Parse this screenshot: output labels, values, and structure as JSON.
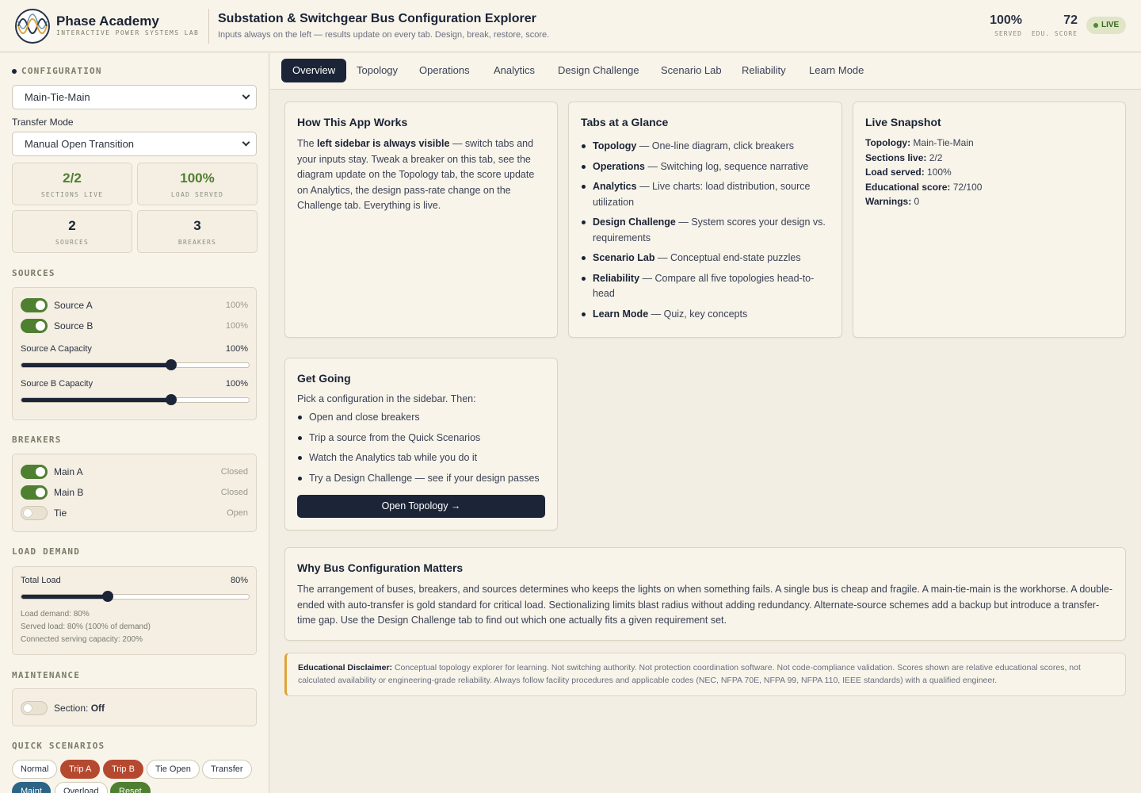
{
  "brand": {
    "name": "Phase Academy",
    "tagline": "INTERACTIVE POWER SYSTEMS LAB"
  },
  "app": {
    "title": "Substation & Switchgear Bus Configuration Explorer",
    "subtitle": "Inputs always on the left — results update on every tab. Design, break, restore, score."
  },
  "header_stats": [
    {
      "value": "100%",
      "label": "SERVED"
    },
    {
      "value": "72",
      "label": "EDU. SCORE"
    }
  ],
  "live_badge": "LIVE",
  "colors": {
    "navy": "#1c2438",
    "green": "#4f7f31",
    "red": "#b5492f",
    "blue": "#2b6486",
    "amber": "#e0a33a",
    "cream": "#f8f4ea"
  },
  "sidebar": {
    "config_title": "CONFIGURATION",
    "configuration": "Main-Tie-Main",
    "transfer_label": "Transfer Mode",
    "transfer_mode": "Manual Open Transition",
    "kpis": [
      {
        "value": "2/2",
        "label": "SECTIONS LIVE",
        "color": "#4f7f31"
      },
      {
        "value": "100%",
        "label": "LOAD SERVED",
        "color": "#4f7f31"
      },
      {
        "value": "2",
        "label": "SOURCES",
        "color": "#1a2235"
      },
      {
        "value": "3",
        "label": "BREAKERS",
        "color": "#1a2235"
      }
    ],
    "sources_title": "SOURCES",
    "sources": [
      {
        "label": "Source A",
        "value": "100%",
        "on": true
      },
      {
        "label": "Source B",
        "value": "100%",
        "on": true
      }
    ],
    "sliders": [
      {
        "label": "Source A Capacity",
        "value": "100%",
        "fraction": 0.66
      },
      {
        "label": "Source B Capacity",
        "value": "100%",
        "fraction": 0.66
      }
    ],
    "breakers_title": "BREAKERS",
    "breakers": [
      {
        "label": "Main A",
        "state": "Closed",
        "on": true
      },
      {
        "label": "Main B",
        "state": "Closed",
        "on": true
      },
      {
        "label": "Tie",
        "state": "Open",
        "on": false
      }
    ],
    "load_title": "LOAD DEMAND",
    "load": {
      "label": "Total Load",
      "value": "80%",
      "fraction": 0.38,
      "notes": [
        "Load demand: 80%",
        "Served load: 80% (100% of demand)",
        "Connected serving capacity: 200%"
      ]
    },
    "maint_title": "MAINTENANCE",
    "maintenance": {
      "prefix": "Section:",
      "state": "Off"
    },
    "scen_title": "QUICK SCENARIOS",
    "scenarios": [
      {
        "label": "Normal",
        "style": "plain"
      },
      {
        "label": "Trip A",
        "style": "red"
      },
      {
        "label": "Trip B",
        "style": "red"
      },
      {
        "label": "Tie Open",
        "style": "plain"
      },
      {
        "label": "Transfer",
        "style": "plain"
      },
      {
        "label": "Maint",
        "style": "blue"
      },
      {
        "label": "Overload",
        "style": "plain"
      },
      {
        "label": "Reset",
        "style": "green"
      }
    ]
  },
  "tabs": [
    "Overview",
    "Topology",
    "Operations",
    "Analytics",
    "Design Challenge",
    "Scenario Lab",
    "Reliability",
    "Learn Mode"
  ],
  "how": {
    "title": "How This App Works",
    "p1": "The ",
    "bold": "left sidebar is always visible",
    "p2": " — switch tabs and your inputs stay. Tweak a breaker on this tab, see the diagram update on the Topology tab, the score update on Analytics, the design pass-rate change on the Challenge tab. Everything is live."
  },
  "glance": {
    "title": "Tabs at a Glance",
    "items": [
      {
        "name": "Topology",
        "desc": " — One-line diagram, click breakers"
      },
      {
        "name": "Operations",
        "desc": " — Switching log, sequence narrative"
      },
      {
        "name": "Analytics",
        "desc": " — Live charts: load distribution, source utilization"
      },
      {
        "name": "Design Challenge",
        "desc": " — System scores your design vs. requirements"
      },
      {
        "name": "Scenario Lab",
        "desc": " — Conceptual end-state puzzles"
      },
      {
        "name": "Reliability",
        "desc": " — Compare all five topologies head-to-head"
      },
      {
        "name": "Learn Mode",
        "desc": " — Quiz, key concepts"
      }
    ]
  },
  "snapshot": {
    "title": "Live Snapshot",
    "rows": [
      {
        "k": "Topology:",
        "v": " Main-Tie-Main"
      },
      {
        "k": "Sections live:",
        "v": " 2/2"
      },
      {
        "k": "Load served:",
        "v": " 100%"
      },
      {
        "k": "Educational score:",
        "v": " 72/100"
      },
      {
        "k": "Warnings:",
        "v": " 0"
      }
    ]
  },
  "going": {
    "title": "Get Going",
    "intro": "Pick a configuration in the sidebar. Then:",
    "items": [
      "Open and close breakers",
      "Trip a source from the Quick Scenarios",
      "Watch the Analytics tab while you do it",
      "Try a Design Challenge — see if your design passes"
    ],
    "button": "Open Topology →"
  },
  "why": {
    "title": "Why Bus Configuration Matters",
    "text": "The arrangement of buses, breakers, and sources determines who keeps the lights on when something fails. A single bus is cheap and fragile. A main-tie-main is the workhorse. A double-ended with auto-transfer is gold standard for critical load. Sectionalizing limits blast radius without adding redundancy. Alternate-source schemes add a backup but introduce a transfer-time gap. Use the Design Challenge tab to find out which one actually fits a given requirement set."
  },
  "disclaimer": {
    "label": "Educational Disclaimer:",
    "text": " Conceptual topology explorer for learning. Not switching authority. Not protection coordination software. Not code-compliance validation. Scores shown are relative educational scores, not calculated availability or engineering-grade reliability. Always follow facility procedures and applicable codes (NEC, NFPA 70E, NFPA 99, NFPA 110, IEEE standards) with a qualified engineer."
  }
}
